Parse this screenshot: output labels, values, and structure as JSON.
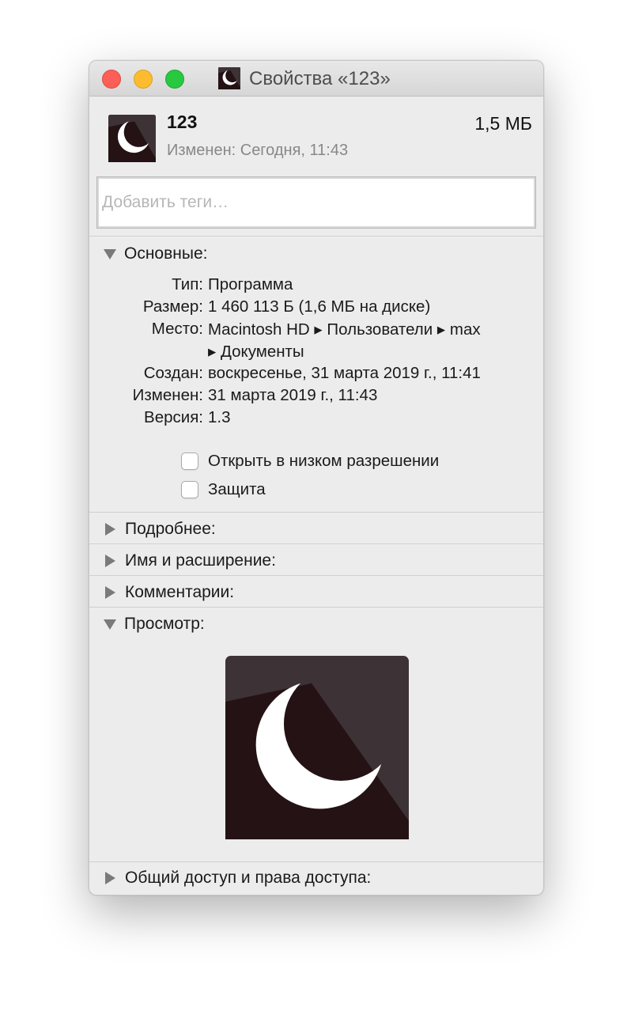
{
  "window": {
    "title": "Свойства «123»"
  },
  "header": {
    "name": "123",
    "size": "1,5 МБ",
    "modified": "Изменен: Сегодня, 11:43",
    "icon": "moon-app-icon"
  },
  "tags": {
    "placeholder": "Добавить теги…",
    "value": ""
  },
  "general": {
    "label": "Основные:",
    "expanded": true,
    "rows": [
      {
        "label": "Тип:",
        "value": "Программа"
      },
      {
        "label": "Размер:",
        "value": "1 460 113 Б (1,6 МБ на диске)"
      },
      {
        "label": "Место:",
        "value": "Macintosh HD ▸ Пользователи ▸ max"
      },
      {
        "label": "",
        "value": "▸ Документы"
      },
      {
        "label": "Создан:",
        "value": "воскресенье, 31 марта 2019 г., 11:41"
      },
      {
        "label": "Изменен:",
        "value": "31 марта 2019 г., 11:43"
      },
      {
        "label": "Версия:",
        "value": "1.3"
      }
    ],
    "checkboxes": [
      {
        "label": "Открыть в низком разрешении",
        "checked": false
      },
      {
        "label": "Защита",
        "checked": false
      }
    ]
  },
  "sections": {
    "more_info": "Подробнее:",
    "name_ext": "Имя и расширение:",
    "comments": "Комментарии:",
    "preview": "Просмотр:",
    "sharing": "Общий доступ и права доступа:"
  },
  "colors": {
    "icon_bg": "#3d3236",
    "icon_shadow": "#241214",
    "moon": "#ffffff"
  }
}
